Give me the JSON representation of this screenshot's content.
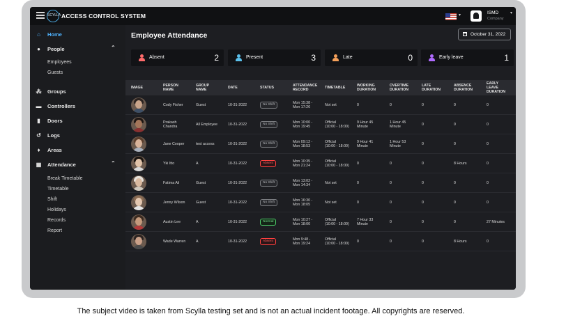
{
  "app": {
    "title": "ACCESS CONTROL SYSTEM",
    "logo_text": "SCYLLA",
    "user": {
      "name": "ISMD",
      "org": "Company"
    },
    "language_flag": "us-flag-icon"
  },
  "sidebar": {
    "items": [
      {
        "label": "Home",
        "icon": "home-icon",
        "active": true
      },
      {
        "label": "People",
        "icon": "person-icon",
        "expanded": true,
        "children": [
          "Employees",
          "Guests"
        ]
      },
      {
        "label": "Groups",
        "icon": "groups-icon"
      },
      {
        "label": "Controllers",
        "icon": "controller-icon"
      },
      {
        "label": "Doors",
        "icon": "door-icon"
      },
      {
        "label": "Logs",
        "icon": "history-icon"
      },
      {
        "label": "Areas",
        "icon": "location-pin-icon"
      },
      {
        "label": "Attendance",
        "icon": "calendar-icon",
        "expanded": true,
        "children": [
          "Break Timetable",
          "Timetable",
          "Shift",
          "Holidays",
          "Records",
          "Report"
        ]
      }
    ],
    "chevrons": {
      "people": "⌃",
      "attendance": "⌃"
    }
  },
  "page": {
    "title": "Employee Attendance",
    "date": "October 31, 2022"
  },
  "stats": [
    {
      "label": "Absent",
      "value": "2",
      "color": "#ff6b6b"
    },
    {
      "label": "Present",
      "value": "3",
      "color": "#5bc0eb"
    },
    {
      "label": "Late",
      "value": "0",
      "color": "#f5a05a"
    },
    {
      "label": "Early leave",
      "value": "1",
      "color": "#b06bff"
    }
  ],
  "table": {
    "headers": [
      "IMAGE",
      "PERSON\nNAME",
      "GROUP\nNAME",
      "DATE",
      "STATUS",
      "ATTENDANCE\nRECORD",
      "TIMETABLE",
      "WORKING\nDURATION",
      "OVERTIME\nDURATION",
      "LATE\nDURATION",
      "ABSENCE\nDURATION",
      "EARLY\nLEAVE\nDURATION"
    ],
    "rows": [
      {
        "name": "Cody Fisher",
        "group": "Guest",
        "date": "10-31-2022",
        "status": "No Shift",
        "status_type": "no-shift",
        "record": "Mon 15:38 -\nMon 17:26",
        "timetable": "Not set",
        "working": "0",
        "overtime": "0",
        "late": "0",
        "absence": "0",
        "early": "0",
        "skin": "#c9a48a",
        "hair": "#2b2320",
        "shirt": "#3d4f66"
      },
      {
        "name": "Prakash\nChandra",
        "group": "All Employee",
        "date": "10-31-2022",
        "status": "No Shift",
        "status_type": "no-shift",
        "record": "Mon 10:00 -\nMon 19:45",
        "timetable": "Official\n(10:00 - 18:00)",
        "working": "9 Hour 45\nMinute",
        "overtime": "1 Hour 45\nMinute",
        "late": "0",
        "absence": "0",
        "early": "0",
        "skin": "#a4765a",
        "hair": "#1e1714",
        "shirt": "#8a3030"
      },
      {
        "name": "Jane Cooper",
        "group": "test access",
        "date": "10-31-2022",
        "status": "No Shift",
        "status_type": "no-shift",
        "record": "Mon 09:12 -\nMon 18:53",
        "timetable": "Official\n(10:00 - 18:00)",
        "working": "9 Hour 41\nMinute",
        "overtime": "1 Hour 53\nMinute",
        "late": "0",
        "absence": "0",
        "early": "0",
        "skin": "#d8b39a",
        "hair": "#5a3d2b",
        "shirt": "#a8b0bd"
      },
      {
        "name": "Yki Itto",
        "group": "A",
        "date": "10-31-2022",
        "status": "Absent",
        "status_type": "absent",
        "record": "Mon 10:35 -\nMon 21:24",
        "timetable": "Official\n(10:00 - 18:00)",
        "working": "0",
        "overtime": "0",
        "late": "0",
        "absence": "8 Hours",
        "early": "0",
        "skin": "#e0c2a8",
        "hair": "#1a1410",
        "shirt": "#d9d9d9"
      },
      {
        "name": "Fatima Ali",
        "group": "Guest",
        "date": "10-31-2022",
        "status": "No Shift",
        "status_type": "no-shift",
        "record": "Mon 13:02 -\nMon 14:34",
        "timetable": "Not set",
        "working": "0",
        "overtime": "0",
        "late": "0",
        "absence": "0",
        "early": "0",
        "skin": "#d9b99f",
        "hair": "#e6e1da",
        "shirt": "#cfc8bd"
      },
      {
        "name": "Jenny Wilson",
        "group": "Guest",
        "date": "10-31-2022",
        "status": "No Shift",
        "status_type": "no-shift",
        "record": "Mon 16:30 -\nMon 18:05",
        "timetable": "Not set",
        "working": "0",
        "overtime": "0",
        "late": "0",
        "absence": "0",
        "early": "0",
        "skin": "#e3c7b0",
        "hair": "#8a6b52",
        "shirt": "#e5e5e5"
      },
      {
        "name": "Austin Lee",
        "group": "A",
        "date": "10-31-2022",
        "status": "Normal",
        "status_type": "normal",
        "record": "Mon 10:27 -\nMon 18:00",
        "timetable": "Official\n(10:00 - 18:00)",
        "working": "7 Hour 33\nMinute",
        "overtime": "0",
        "late": "0",
        "absence": "0",
        "early": "27 Minutes",
        "skin": "#c49a7c",
        "hair": "#3a2a20",
        "shirt": "#b33a3a"
      },
      {
        "name": "Wade Warren",
        "group": "A",
        "date": "10-31-2022",
        "status": "Absent",
        "status_type": "absent",
        "record": "Mon 9:48 -\nMon 19:24",
        "timetable": "Official\n(10:00 - 18:00)",
        "working": "0",
        "overtime": "0",
        "late": "0",
        "absence": "8 Hours",
        "early": "0",
        "skin": "#caa088",
        "hair": "#2a2220",
        "shirt": "#4a4a4a"
      }
    ]
  },
  "caption": "The subject video is taken from Scylla testing set and is not an actual incident footage. All copyrights are reserved."
}
